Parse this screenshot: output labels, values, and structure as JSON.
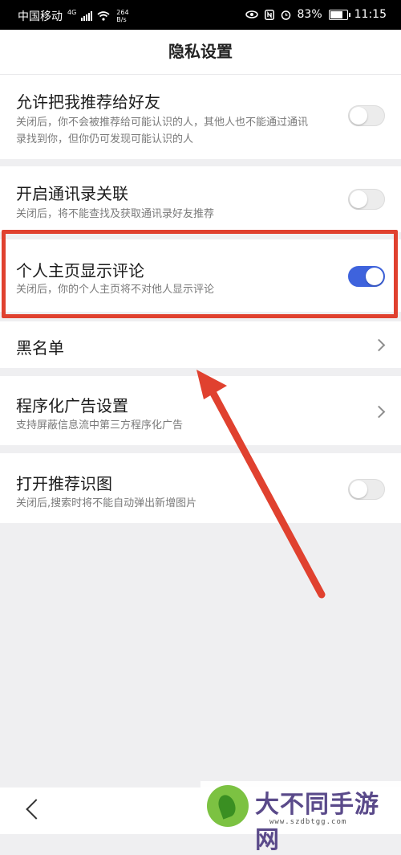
{
  "status_bar": {
    "carrier": "中国移动",
    "network_type": "4G",
    "speed_value": "264",
    "speed_unit": "B/s",
    "battery": "83%",
    "battery_level": 0.83,
    "time": "11:15",
    "icons": [
      "signal-icon",
      "wifi-icon",
      "eye-comfort-icon",
      "nfc-icon",
      "alarm-icon",
      "battery-icon"
    ]
  },
  "header": {
    "title": "隐私设置"
  },
  "settings": [
    {
      "title": "允许把我推荐给好友",
      "desc": "关闭后，你不会被推荐给可能认识的人，其他人也不能通过通讯录找到你，但你仍可发现可能认识的人",
      "control": "toggle",
      "on": false
    },
    {
      "title": "开启通讯录关联",
      "desc": "关闭后，将不能查找及获取通讯录好友推荐",
      "control": "toggle",
      "on": false
    },
    {
      "title": "个人主页显示评论",
      "desc": "关闭后，你的个人主页将不对他人显示评论",
      "control": "toggle",
      "on": true
    },
    {
      "title": "黑名单",
      "desc": "",
      "control": "chevron"
    },
    {
      "title": "程序化广告设置",
      "desc": "支持屏蔽信息流中第三方程序化广告",
      "control": "chevron"
    },
    {
      "title": "打开推荐识图",
      "desc": "关闭后,搜索时将不能自动弹出新增图片",
      "control": "toggle",
      "on": false
    }
  ],
  "colors": {
    "toggle_on": "#3e63dd",
    "highlight": "#e0412f",
    "arrow": "#e0412f"
  },
  "watermark": {
    "name": "大不同手游网",
    "url": "www.szdbtgg.com"
  }
}
